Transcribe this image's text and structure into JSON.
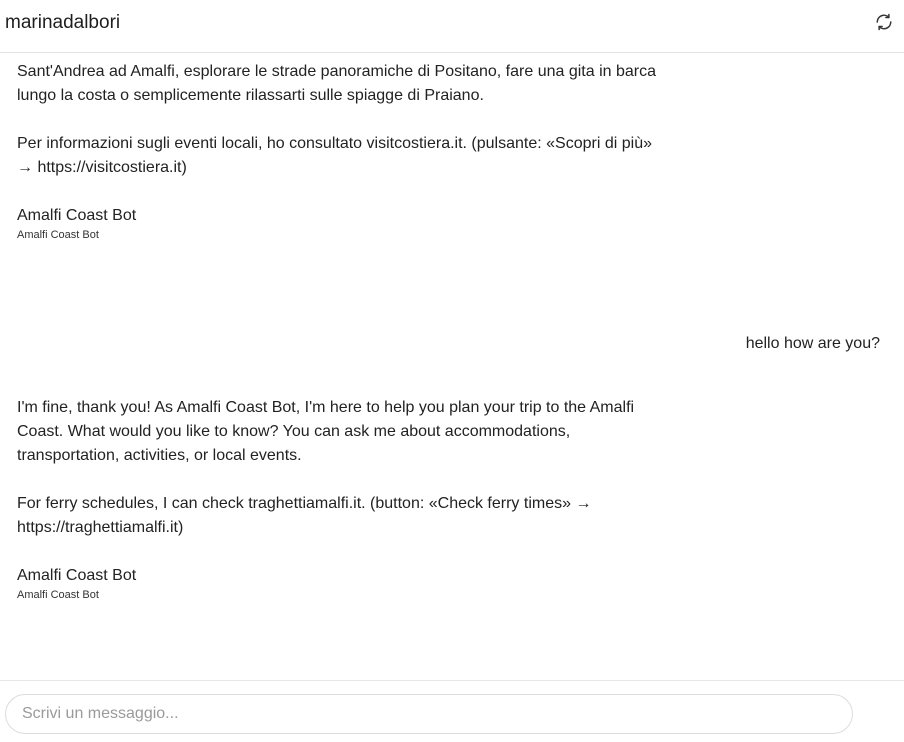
{
  "header": {
    "title": "marinadalbori",
    "refresh_icon": "refresh-icon"
  },
  "messages": {
    "bot_1": {
      "para_1": "Sant'Andrea ad Amalfi, esplorare le strade panoramiche di Positano, fare una gita in barca lungo la costa o semplicemente rilassarti sulle spiagge di Praiano.",
      "para_2": "Per informazioni sugli eventi locali, ho consultato visitcostiera.it. (pulsante: «Scopri di più» → https://visitcostiera.it)",
      "sender": "Amalfi Coast Bot",
      "sender_sub": "Amalfi Coast Bot"
    },
    "user_1": {
      "text": "hello how are you?"
    },
    "bot_2": {
      "para_1": "I'm fine, thank you! As Amalfi Coast Bot, I'm here to help you plan your trip to the Amalfi Coast. What would you like to know? You can ask me about accommodations, transportation, activities, or local events.",
      "para_2": "For ferry schedules, I can check traghettiamalfi.it. (button: «Check ferry times» → https://traghettiamalfi.it)",
      "sender": "Amalfi Coast Bot",
      "sender_sub": "Amalfi Coast Bot"
    }
  },
  "composer": {
    "placeholder": "Scrivi un messaggio..."
  }
}
